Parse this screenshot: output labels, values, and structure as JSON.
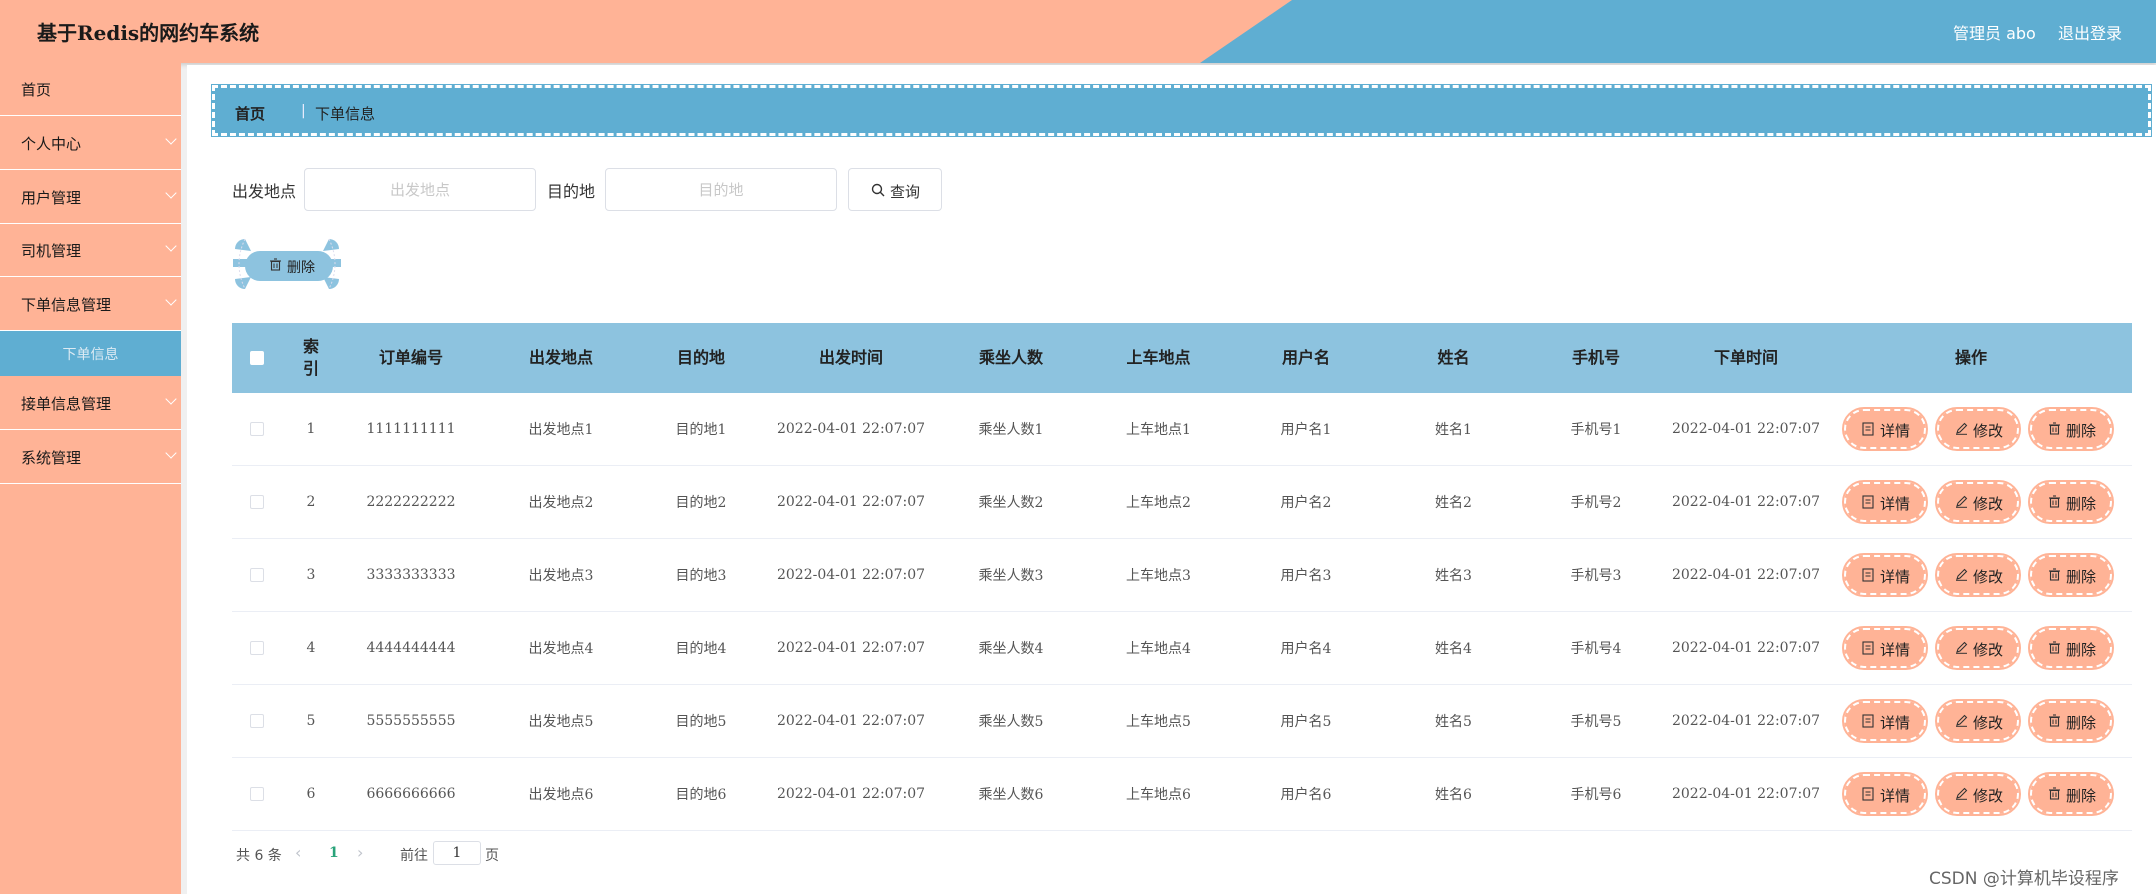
{
  "header": {
    "title": "基于Redis的网约车系统",
    "admin": "管理员 abo",
    "logout": "退出登录"
  },
  "sidebar": {
    "items": [
      {
        "label": "首页",
        "has_chevron": false
      },
      {
        "label": "个人中心",
        "has_chevron": true
      },
      {
        "label": "用户管理",
        "has_chevron": true
      },
      {
        "label": "司机管理",
        "has_chevron": true
      },
      {
        "label": "下单信息管理",
        "has_chevron": true
      },
      {
        "label": "下单信息",
        "submenu": true,
        "active": true
      },
      {
        "label": "接单信息管理",
        "has_chevron": true
      },
      {
        "label": "系统管理",
        "has_chevron": true
      }
    ]
  },
  "breadcrumb": {
    "home": "首页",
    "separator": "|",
    "current": "下单信息"
  },
  "search": {
    "departure_label": "出发地点",
    "departure_placeholder": "出发地点",
    "departure_value": "",
    "destination_label": "目的地",
    "destination_placeholder": "目的地",
    "destination_value": "",
    "button": "查询"
  },
  "bulk_delete": "删除",
  "table": {
    "columns": [
      "索引",
      "订单编号",
      "出发地点",
      "目的地",
      "出发时间",
      "乘坐人数",
      "上车地点",
      "用户名",
      "姓名",
      "手机号",
      "下单时间",
      "操作"
    ],
    "index_header_lines": [
      "索",
      "引"
    ],
    "rows": [
      {
        "index": "1",
        "order_no": "1111111111",
        "departure": "出发地点1",
        "destination": "目的地1",
        "depart_time": "2022-04-01 22:07:07",
        "passengers": "乘坐人数1",
        "pickup": "上车地点1",
        "username": "用户名1",
        "name": "姓名1",
        "phone": "手机号1",
        "order_time": "2022-04-01 22:07:07"
      },
      {
        "index": "2",
        "order_no": "2222222222",
        "departure": "出发地点2",
        "destination": "目的地2",
        "depart_time": "2022-04-01 22:07:07",
        "passengers": "乘坐人数2",
        "pickup": "上车地点2",
        "username": "用户名2",
        "name": "姓名2",
        "phone": "手机号2",
        "order_time": "2022-04-01 22:07:07"
      },
      {
        "index": "3",
        "order_no": "3333333333",
        "departure": "出发地点3",
        "destination": "目的地3",
        "depart_time": "2022-04-01 22:07:07",
        "passengers": "乘坐人数3",
        "pickup": "上车地点3",
        "username": "用户名3",
        "name": "姓名3",
        "phone": "手机号3",
        "order_time": "2022-04-01 22:07:07"
      },
      {
        "index": "4",
        "order_no": "4444444444",
        "departure": "出发地点4",
        "destination": "目的地4",
        "depart_time": "2022-04-01 22:07:07",
        "passengers": "乘坐人数4",
        "pickup": "上车地点4",
        "username": "用户名4",
        "name": "姓名4",
        "phone": "手机号4",
        "order_time": "2022-04-01 22:07:07"
      },
      {
        "index": "5",
        "order_no": "5555555555",
        "departure": "出发地点5",
        "destination": "目的地5",
        "depart_time": "2022-04-01 22:07:07",
        "passengers": "乘坐人数5",
        "pickup": "上车地点5",
        "username": "用户名5",
        "name": "姓名5",
        "phone": "手机号5",
        "order_time": "2022-04-01 22:07:07"
      },
      {
        "index": "6",
        "order_no": "6666666666",
        "departure": "出发地点6",
        "destination": "目的地6",
        "depart_time": "2022-04-01 22:07:07",
        "passengers": "乘坐人数6",
        "pickup": "上车地点6",
        "username": "用户名6",
        "name": "姓名6",
        "phone": "手机号6",
        "order_time": "2022-04-01 22:07:07"
      }
    ],
    "actions": {
      "detail": "详情",
      "edit": "修改",
      "delete": "删除"
    }
  },
  "pagination": {
    "total": "共 6 条",
    "current_page": "1",
    "goto_prefix": "前往",
    "goto_value": "1",
    "goto_suffix": "页"
  },
  "watermark": "CSDN @计算机毕设程序",
  "colors": {
    "salmon": "#FFB396",
    "blue": "#5FAED2",
    "light_blue": "#8DC3DF",
    "active_page": "#29A37A"
  },
  "icons": {
    "search": "search-icon",
    "delete": "trash-icon",
    "detail": "document-icon",
    "edit": "pencil-icon",
    "expand": "chevron-down-icon",
    "prev": "chevron-left-icon",
    "next": "chevron-right-icon"
  }
}
